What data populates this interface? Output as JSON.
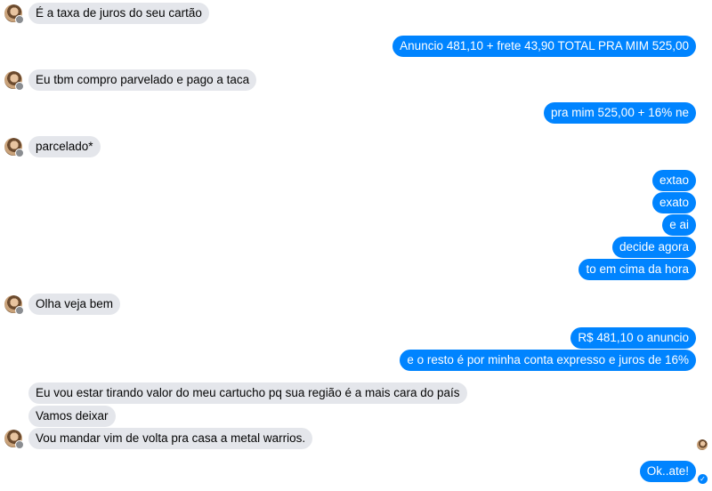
{
  "messages": [
    {
      "dir": "in",
      "text": "É a taxa de juros do seu cartão"
    },
    {
      "dir": "out",
      "text": "Anuncio 481,10 + frete 43,90 TOTAL PRA MIM 525,00"
    },
    {
      "dir": "in",
      "text": "Eu tbm compro parvelado e pago a taca"
    },
    {
      "dir": "out",
      "text": "pra mim 525,00 + 16% ne"
    },
    {
      "dir": "in",
      "text": "parcelado*"
    },
    {
      "dir": "out",
      "text": "extao"
    },
    {
      "dir": "out",
      "text": "exato"
    },
    {
      "dir": "out",
      "text": "e ai"
    },
    {
      "dir": "out",
      "text": "decide agora"
    },
    {
      "dir": "out",
      "text": "to em cima da hora"
    },
    {
      "dir": "in",
      "text": "Olha veja bem"
    },
    {
      "dir": "out",
      "text": "R$ 481,10 o anuncio"
    },
    {
      "dir": "out",
      "text": "e o resto é por minha conta expresso e juros de 16%"
    },
    {
      "dir": "in",
      "text": "Eu vou estar tirando valor do meu cartucho pq sua região é a mais cara do país"
    },
    {
      "dir": "in",
      "text": "Vamos deixar"
    },
    {
      "dir": "in",
      "text": "Vou mandar vim de volta pra casa a metal warrios."
    },
    {
      "dir": "out",
      "text": "Ok..ate!"
    }
  ],
  "icons": {
    "avatar": "contact-avatar-icon",
    "seen": "seen-avatar-icon",
    "delivered": "delivered-check-icon"
  },
  "colors": {
    "incoming_bg": "#e4e6eb",
    "outgoing_bg": "#0084ff"
  }
}
